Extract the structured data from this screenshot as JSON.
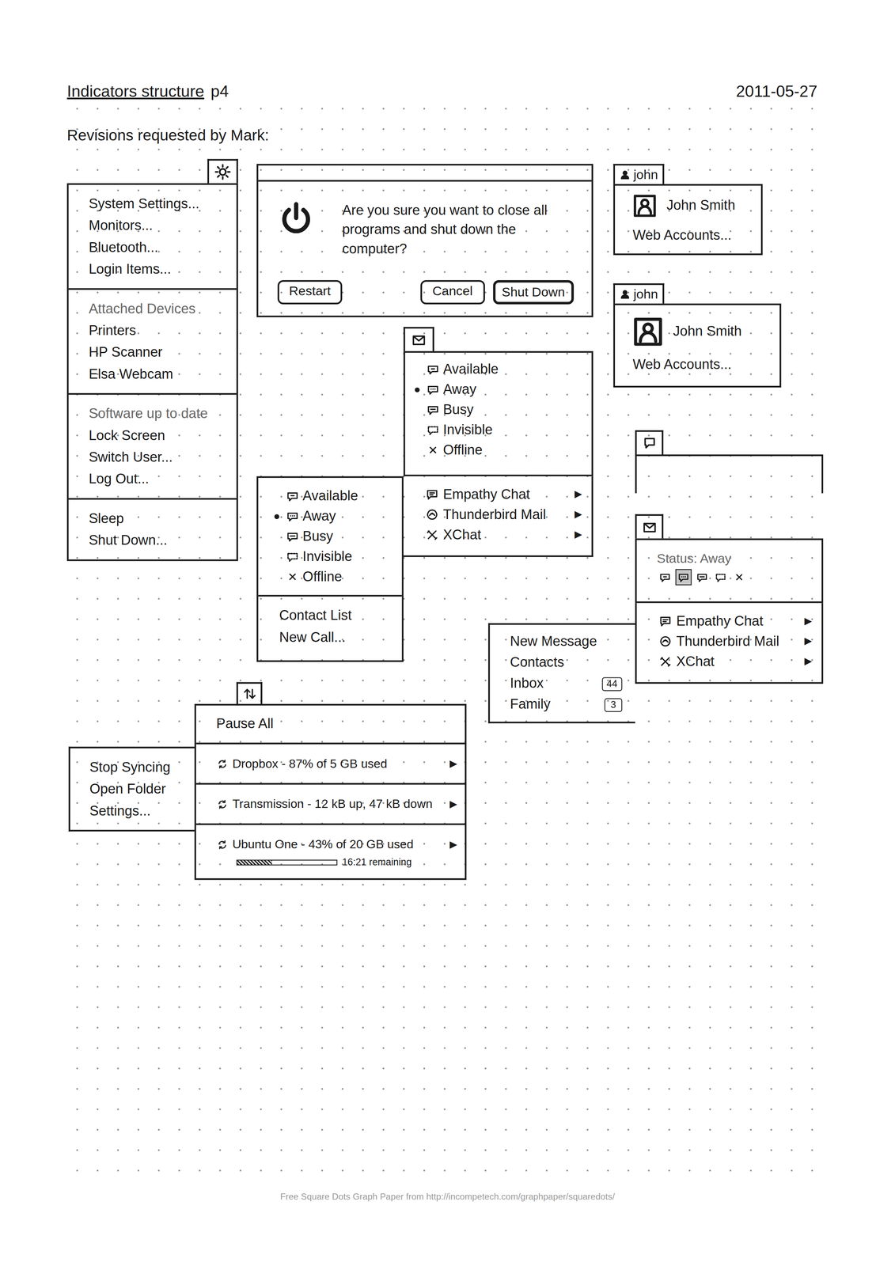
{
  "page": {
    "title": "Indicators structure",
    "page_number": "p4",
    "date": "2011-05-27",
    "subtitle": "Revisions requested by Mark:",
    "footer": "Free Square Dots Graph Paper from http://incompetech.com/graphpaper/squaredots/"
  },
  "system_menu": {
    "sections": [
      {
        "items": [
          {
            "label": "System Settings...",
            "disabled": false
          },
          {
            "label": "Monitors...",
            "disabled": false
          },
          {
            "label": "Bluetooth...",
            "disabled": false
          },
          {
            "label": "Login Items...",
            "disabled": false
          }
        ]
      },
      {
        "items": [
          {
            "label": "Attached Devices",
            "disabled": true
          },
          {
            "label": "Printers",
            "disabled": false
          },
          {
            "label": "HP Scanner",
            "disabled": false
          },
          {
            "label": "Elsa Webcam",
            "disabled": false
          }
        ]
      },
      {
        "items": [
          {
            "label": "Software up to date",
            "disabled": true
          },
          {
            "label": "Lock Screen",
            "disabled": false
          },
          {
            "label": "Switch User...",
            "disabled": false
          },
          {
            "label": "Log Out...",
            "disabled": false
          }
        ]
      },
      {
        "items": [
          {
            "label": "Sleep",
            "disabled": false
          },
          {
            "label": "Shut Down...",
            "disabled": false
          }
        ]
      }
    ]
  },
  "shutdown_dialog": {
    "message": "Are you sure you want to close all programs and shut down the computer?",
    "buttons": [
      {
        "label": "Restart",
        "default": false
      },
      {
        "label": "Cancel",
        "default": false
      },
      {
        "label": "Shut Down",
        "default": true
      }
    ]
  },
  "user_menus": [
    {
      "tab": "john",
      "name": "John Smith",
      "items": [
        "Web Accounts..."
      ]
    },
    {
      "tab": "john",
      "name": "John Smith",
      "items": [
        "Web Accounts..."
      ]
    }
  ],
  "messaging_menu": {
    "statuses": [
      {
        "label": "Available",
        "kind": "available",
        "selected": false
      },
      {
        "label": "Away",
        "kind": "away",
        "selected": true
      },
      {
        "label": "Busy",
        "kind": "busy",
        "selected": false
      },
      {
        "label": "Invisible",
        "kind": "invisible",
        "selected": false
      },
      {
        "label": "Offline",
        "kind": "offline",
        "selected": false
      }
    ],
    "apps": [
      {
        "label": "Empathy Chat",
        "kind": "empathy",
        "arrow": "▶"
      },
      {
        "label": "Thunderbird Mail",
        "kind": "thunderbird",
        "arrow": "▶"
      },
      {
        "label": "XChat",
        "kind": "xchat",
        "arrow": "▶"
      }
    ],
    "submenu": {
      "statuses": [
        {
          "label": "Available",
          "kind": "available",
          "selected": false
        },
        {
          "label": "Away",
          "kind": "away",
          "selected": true
        },
        {
          "label": "Busy",
          "kind": "busy",
          "selected": false
        },
        {
          "label": "Invisible",
          "kind": "invisible",
          "selected": false
        },
        {
          "label": "Offline",
          "kind": "offline",
          "selected": false
        }
      ],
      "actions": [
        "Contact List",
        "New Call..."
      ]
    }
  },
  "messaging_menu_compact": {
    "status_label": "Status: Away",
    "status_icons": [
      {
        "kind": "available",
        "selected": false
      },
      {
        "kind": "away",
        "selected": true
      },
      {
        "kind": "busy",
        "selected": false
      },
      {
        "kind": "invisible",
        "selected": false
      },
      {
        "kind": "offline",
        "selected": false
      }
    ],
    "apps": [
      {
        "label": "Empathy Chat",
        "kind": "empathy",
        "arrow": "▶"
      },
      {
        "label": "Thunderbird Mail",
        "kind": "thunderbird",
        "arrow": "▶"
      },
      {
        "label": "XChat",
        "kind": "xchat",
        "arrow": "▶"
      }
    ],
    "submenu": [
      {
        "label": "New Message",
        "count": null
      },
      {
        "label": "Contacts",
        "count": null
      },
      {
        "label": "Inbox",
        "count": "44"
      },
      {
        "label": "Family",
        "count": "3"
      }
    ]
  },
  "sync_menu": {
    "pause": "Pause All",
    "items": [
      {
        "label": "Dropbox - 87% of 5 GB used",
        "arrow": "▶",
        "progress": null
      },
      {
        "label": "Transmission - 12 kB up, 47 kB down",
        "arrow": "▶",
        "progress": null
      },
      {
        "label": "Ubuntu One - 43% of 20 GB used",
        "arrow": "▶",
        "progress": {
          "level": 0.35,
          "reading": "16:21 remaining"
        }
      }
    ],
    "submenu": [
      "Stop Syncing",
      "Open Folder",
      "Settings..."
    ]
  }
}
